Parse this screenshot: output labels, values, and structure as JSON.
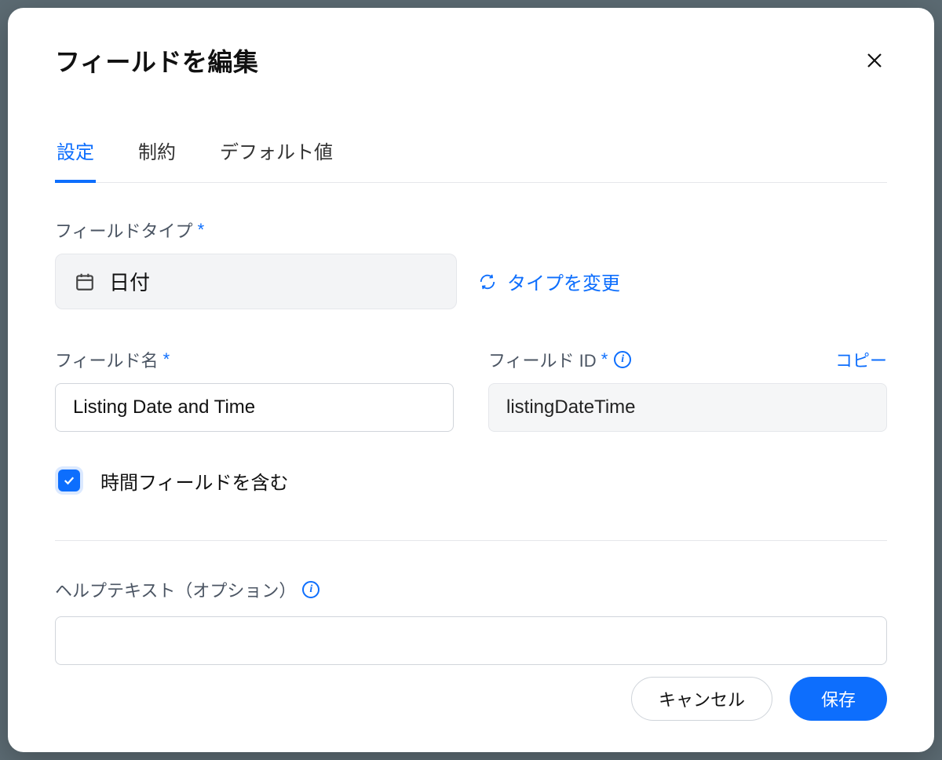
{
  "modal": {
    "title": "フィールドを編集"
  },
  "tabs": {
    "settings": "設定",
    "constraints": "制約",
    "default_value": "デフォルト値"
  },
  "field_type": {
    "label": "フィールドタイプ",
    "value": "日付",
    "change_label": "タイプを変更"
  },
  "field_name": {
    "label": "フィールド名",
    "value": "Listing Date and Time"
  },
  "field_id": {
    "label": "フィールド ID",
    "value": "listingDateTime",
    "copy_label": "コピー"
  },
  "include_time": {
    "label": "時間フィールドを含む",
    "checked": true
  },
  "help_text": {
    "label": "ヘルプテキスト（オプション）",
    "value": ""
  },
  "buttons": {
    "cancel": "キャンセル",
    "save": "保存"
  }
}
